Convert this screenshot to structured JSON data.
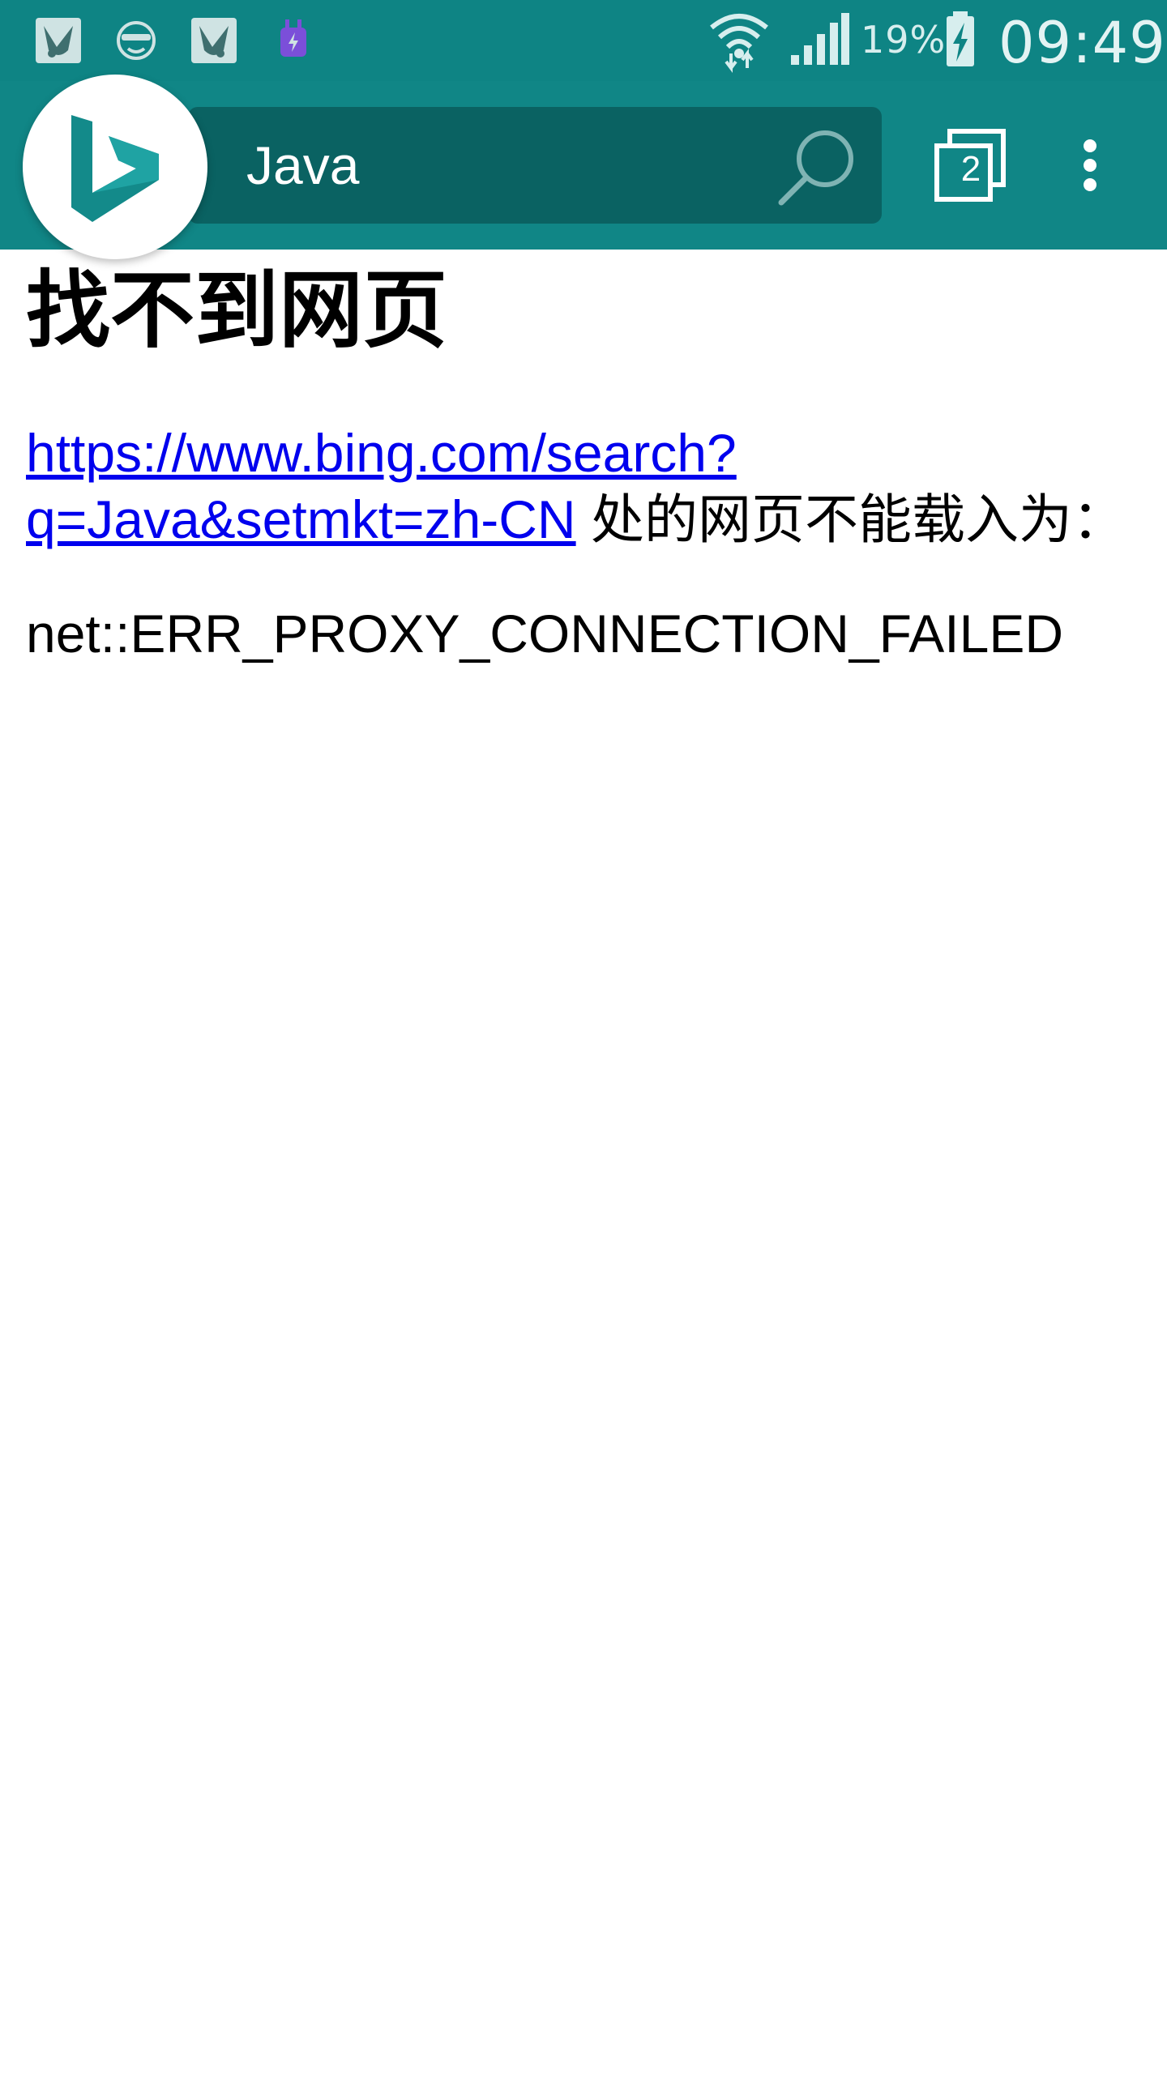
{
  "status_bar": {
    "battery_percent": "19%",
    "time": "09:49",
    "icons": [
      "pigeon-icon",
      "face-icon",
      "pigeon-icon",
      "plug-icon",
      "wifi-icon",
      "signal-icon",
      "battery-charging-icon"
    ]
  },
  "toolbar": {
    "query": "Java",
    "tab_count": "2",
    "logo": "bing-logo-icon",
    "search_icon": "search-icon",
    "menu_icon": "overflow-menu-icon"
  },
  "page": {
    "title": "找不到网页",
    "url_line1": "https://www.bing.com/search?",
    "url_line2": "q=Java&setmkt=zh-CN",
    "message_suffix": " 处的网页不能载入为：",
    "error_code": "net::ERR_PROXY_CONNECTION_FAILED"
  },
  "colors": {
    "toolbar_bg": "#108686",
    "search_bg": "#0a6262",
    "link": "#0000ee"
  }
}
